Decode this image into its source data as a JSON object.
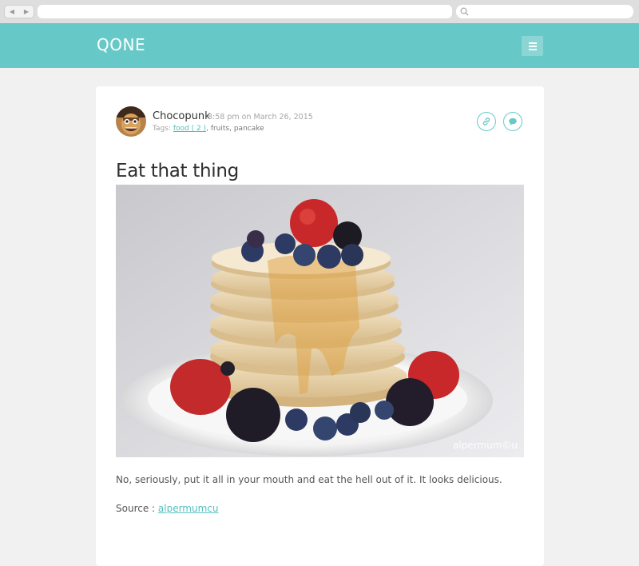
{
  "browser": {
    "back_icon": "back-arrow-icon",
    "forward_icon": "forward-arrow-icon",
    "search_icon": "search-icon",
    "url_value": "",
    "search_value": ""
  },
  "header": {
    "brand": "QONE",
    "menu_icon": "hamburger-menu-icon",
    "color": "#67c9c7"
  },
  "post": {
    "author": "Chocopunk",
    "time": "8:58 pm on March 26, 2015",
    "tags_label": "Tags:",
    "tags": [
      {
        "label": "food ( 2 )",
        "link": true
      },
      {
        "label": "fruits",
        "link": false
      },
      {
        "label": "pancake",
        "link": false
      }
    ],
    "tag_separator": ", ",
    "actions": [
      "link-icon",
      "comment-icon"
    ],
    "title": "Eat that thing",
    "image_watermark": "alpermum©u",
    "body": "No, seriously, put it all in your mouth and eat the hell out of it. It looks delicious.",
    "source_label": "Source : ",
    "source_link": "alpermumcu"
  }
}
